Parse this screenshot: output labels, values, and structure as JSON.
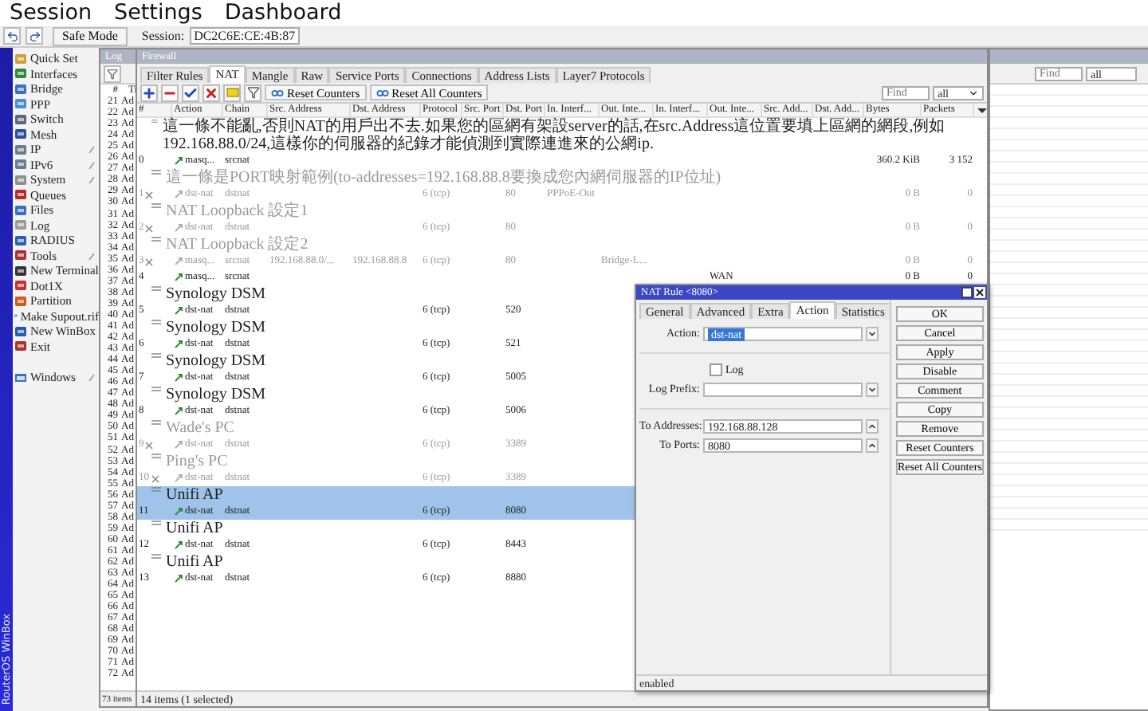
{
  "menu": [
    "Session",
    "Settings",
    "Dashboard"
  ],
  "toolbar": {
    "safe_mode": "Safe Mode",
    "session_label": "Session:",
    "session_value": "DC2C6E:CE:4B:87"
  },
  "sidebar": {
    "brand": "RouterOS WinBox",
    "items": [
      {
        "label": "Quick Set",
        "has_submenu": false
      },
      {
        "label": "Interfaces",
        "has_submenu": false
      },
      {
        "label": "Bridge",
        "has_submenu": false
      },
      {
        "label": "PPP",
        "has_submenu": false
      },
      {
        "label": "Switch",
        "has_submenu": false
      },
      {
        "label": "Mesh",
        "has_submenu": false
      },
      {
        "label": "IP",
        "has_submenu": true
      },
      {
        "label": "IPv6",
        "has_submenu": true
      },
      {
        "label": "System",
        "has_submenu": true
      },
      {
        "label": "Queues",
        "has_submenu": false
      },
      {
        "label": "Files",
        "has_submenu": false
      },
      {
        "label": "Log",
        "has_submenu": false
      },
      {
        "label": "RADIUS",
        "has_submenu": false
      },
      {
        "label": "Tools",
        "has_submenu": true
      },
      {
        "label": "New Terminal",
        "has_submenu": false
      },
      {
        "label": "Dot1X",
        "has_submenu": false
      },
      {
        "label": "Partition",
        "has_submenu": false
      },
      {
        "label": "Make Supout.rif",
        "has_submenu": false
      },
      {
        "label": "New WinBox",
        "has_submenu": false
      },
      {
        "label": "Exit",
        "has_submenu": false
      }
    ],
    "bottom_items": [
      {
        "label": "Windows",
        "has_submenu": true
      }
    ]
  },
  "log_window": {
    "title": "Log",
    "columns": [
      "#",
      "Ti"
    ],
    "status": "73 items",
    "rows": [
      {
        "number": "21",
        "text": "Ad"
      },
      {
        "number": "22",
        "text": "Ad"
      },
      {
        "number": "23",
        "text": "Ad"
      },
      {
        "number": "24",
        "text": "Ad"
      },
      {
        "number": "25",
        "text": "Ad"
      },
      {
        "number": "26",
        "text": "Ad"
      },
      {
        "number": "27",
        "text": "Ad"
      },
      {
        "number": "28",
        "text": "Ad"
      },
      {
        "number": "29",
        "text": "Ad"
      },
      {
        "number": "30",
        "text": "Ad"
      },
      {
        "number": "31",
        "text": "Ad"
      },
      {
        "number": "32",
        "text": "Ad"
      },
      {
        "number": "33",
        "text": "Ad"
      },
      {
        "number": "34",
        "text": "Ad"
      },
      {
        "number": "35",
        "text": "Ad"
      },
      {
        "number": "36",
        "text": "Ad"
      },
      {
        "number": "37",
        "text": "Ad"
      },
      {
        "number": "38",
        "text": "Ad"
      },
      {
        "number": "39",
        "text": "Ad"
      },
      {
        "number": "40",
        "text": "Ad"
      },
      {
        "number": "41",
        "text": "Ad"
      },
      {
        "number": "42",
        "text": "Ad"
      },
      {
        "number": "43",
        "text": "Ad"
      },
      {
        "number": "44",
        "text": "Ad"
      },
      {
        "number": "45",
        "text": "Ad"
      },
      {
        "number": "46",
        "text": "Ad"
      },
      {
        "number": "47",
        "text": "Ad"
      },
      {
        "number": "48",
        "text": "Ad"
      },
      {
        "number": "49",
        "text": "Ad"
      },
      {
        "number": "50",
        "text": "Ad"
      },
      {
        "number": "51",
        "text": "Ad"
      },
      {
        "number": "52",
        "text": "Ad"
      },
      {
        "number": "53",
        "text": "Ad"
      },
      {
        "number": "54",
        "text": "Ad"
      },
      {
        "number": "55",
        "text": "Ad"
      },
      {
        "number": "56",
        "text": "Ad"
      },
      {
        "number": "57",
        "text": "Ad"
      },
      {
        "number": "58",
        "text": "Ad"
      },
      {
        "number": "59",
        "text": "Ad"
      },
      {
        "number": "60",
        "text": "Ad"
      },
      {
        "number": "61",
        "text": "Ad"
      },
      {
        "number": "62",
        "text": "Ad"
      },
      {
        "number": "63",
        "text": "Ad"
      },
      {
        "number": "64",
        "text": "Ad"
      },
      {
        "number": "65",
        "text": "Ad"
      },
      {
        "number": "66",
        "text": "Ad"
      },
      {
        "number": "67",
        "text": "Ad"
      },
      {
        "number": "68",
        "text": "Ad"
      },
      {
        "number": "69",
        "text": "Ad"
      },
      {
        "number": "70",
        "text": "Ad"
      },
      {
        "number": "71",
        "text": "Ad"
      },
      {
        "number": "72",
        "text": "Ad"
      }
    ]
  },
  "firewall": {
    "title": "Firewall",
    "tabs": [
      {
        "label": "Filter Rules",
        "selected": false
      },
      {
        "label": "NAT",
        "selected": true
      },
      {
        "label": "Mangle",
        "selected": false
      },
      {
        "label": "Raw",
        "selected": false
      },
      {
        "label": "Service Ports",
        "selected": false
      },
      {
        "label": "Connections",
        "selected": false
      },
      {
        "label": "Address Lists",
        "selected": false
      },
      {
        "label": "Layer7 Protocols",
        "selected": false
      }
    ],
    "toolbar_buttons": [
      "Reset Counters",
      "Reset All Counters"
    ],
    "find": {
      "placeholder": "Find"
    },
    "filter": "all",
    "columns": [
      "#",
      "Action",
      "Chain",
      "Src. Address",
      "Dst. Address",
      "Protocol",
      "Src. Port",
      "Dst. Port",
      "In. Interf...",
      "Out. Inte...",
      "In. Interf...",
      "Out. Inte...",
      "Src. Add...",
      "Dst. Add...",
      "Bytes",
      "Packets"
    ],
    "rules": [
      {
        "number": "0",
        "disabled": false,
        "selected": false,
        "comment": "這一條不能亂,否則NAT的用戶出不去.如果您的區網有架設server的話,在src.Address這位置要填上區網的網段,例如192.168.88.0/24,這樣你的伺服器的紀錄才能偵測到實際連進來的公網ip.",
        "action": "masq...",
        "chain": "srcnat",
        "bytes": "360.2 KiB",
        "packets": "3 152"
      },
      {
        "number": "1",
        "disabled": true,
        "selected": false,
        "comment": "這一條是PORT映射範例(to-addresses=192.168.88.8要換成您內網伺服器的IP位址)",
        "action": "dst-nat",
        "chain": "dstnat",
        "protocol": "6 (tcp)",
        "dst_port": "80",
        "in_interface": "PPPoE-Out",
        "bytes": "0 B",
        "packets": "0"
      },
      {
        "number": "2",
        "disabled": true,
        "selected": false,
        "comment": "NAT Loopback 設定1",
        "action": "dst-nat",
        "chain": "dstnat",
        "protocol": "6 (tcp)",
        "dst_port": "80",
        "bytes": "0 B",
        "packets": "0"
      },
      {
        "number": "3",
        "disabled": true,
        "selected": false,
        "comment": "NAT Loopback 設定2",
        "action": "masq...",
        "chain": "srcnat",
        "src_address": "192.168.88.0/...",
        "dst_address": "192.168.88.8",
        "protocol": "6 (tcp)",
        "dst_port": "80",
        "out_interface": "Bridge-L...",
        "bytes": "0 B",
        "packets": "0"
      },
      {
        "number": "4",
        "disabled": false,
        "selected": false,
        "action": "masq...",
        "chain": "srcnat",
        "out_interface_list": "WAN",
        "bytes": "0 B",
        "packets": "0"
      },
      {
        "number": "5",
        "disabled": false,
        "selected": false,
        "comment": "Synology DSM",
        "action": "dst-nat",
        "chain": "dstnat",
        "protocol": "6 (tcp)",
        "dst_port": "520"
      },
      {
        "number": "6",
        "disabled": false,
        "selected": false,
        "comment": "Synology DSM",
        "action": "dst-nat",
        "chain": "dstnat",
        "protocol": "6 (tcp)",
        "dst_port": "521"
      },
      {
        "number": "7",
        "disabled": false,
        "selected": false,
        "comment": "Synology DSM",
        "action": "dst-nat",
        "chain": "dstnat",
        "protocol": "6 (tcp)",
        "dst_port": "5005"
      },
      {
        "number": "8",
        "disabled": false,
        "selected": false,
        "comment": "Synology DSM",
        "action": "dst-nat",
        "chain": "dstnat",
        "protocol": "6 (tcp)",
        "dst_port": "5006"
      },
      {
        "number": "9",
        "disabled": true,
        "selected": false,
        "comment": "Wade's PC",
        "action": "dst-nat",
        "chain": "dstnat",
        "protocol": "6 (tcp)",
        "dst_port": "3389"
      },
      {
        "number": "10",
        "disabled": true,
        "selected": false,
        "comment": "Ping's PC",
        "action": "dst-nat",
        "chain": "dstnat",
        "protocol": "6 (tcp)",
        "dst_port": "3389"
      },
      {
        "number": "11",
        "disabled": false,
        "selected": true,
        "comment": "Unifi AP",
        "action": "dst-nat",
        "chain": "dstnat",
        "protocol": "6 (tcp)",
        "dst_port": "8080"
      },
      {
        "number": "12",
        "disabled": false,
        "selected": false,
        "comment": "Unifi AP",
        "action": "dst-nat",
        "chain": "dstnat",
        "protocol": "6 (tcp)",
        "dst_port": "8443"
      },
      {
        "number": "13",
        "disabled": false,
        "selected": false,
        "comment": "Unifi AP",
        "action": "dst-nat",
        "chain": "dstnat",
        "protocol": "6 (tcp)",
        "dst_port": "8880"
      }
    ],
    "status": "14 items (1 selected)"
  },
  "nat_dialog": {
    "title": "NAT Rule <8080>",
    "tabs": [
      {
        "label": "General",
        "selected": false
      },
      {
        "label": "Advanced",
        "selected": false
      },
      {
        "label": "Extra",
        "selected": false
      },
      {
        "label": "Action",
        "selected": true
      },
      {
        "label": "Statistics",
        "selected": false
      }
    ],
    "fields": [
      {
        "kind": "select",
        "label": "Action:",
        "value": "dst-nat",
        "highlighted": true,
        "divider_before": false
      },
      {
        "kind": "checkbox",
        "label": "Log",
        "checked": false,
        "divider_before": true
      },
      {
        "kind": "select",
        "label": "Log Prefix:",
        "divider_before": false
      },
      {
        "kind": "text",
        "label": "To Addresses:",
        "value": "192.168.88.128",
        "divider_before": true
      },
      {
        "kind": "text",
        "label": "To Ports:",
        "value": "8080",
        "divider_before": false
      }
    ],
    "buttons": [
      "OK",
      "Cancel",
      "Apply",
      "Disable",
      "Comment",
      "Copy",
      "Remove",
      "Reset Counters",
      "Reset All Counters"
    ],
    "status": "enabled"
  },
  "back_window": {
    "find": {
      "placeholder": "Find"
    },
    "filter": "all"
  }
}
